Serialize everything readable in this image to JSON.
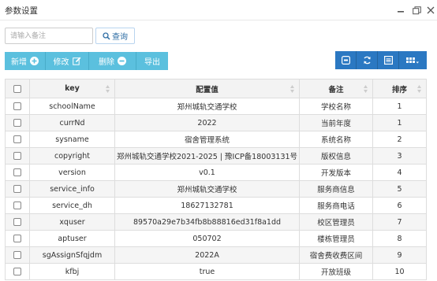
{
  "window": {
    "title": "参数设置"
  },
  "search": {
    "placeholder": "请输入备注",
    "button_label": "查询"
  },
  "actions": {
    "add": "新增",
    "edit": "修改",
    "delete": "删除",
    "export": "导出"
  },
  "columns": {
    "key": "key",
    "value": "配置值",
    "remark": "备注",
    "sort": "排序"
  },
  "rows": [
    {
      "key": "schoolName",
      "value": "郑州城轨交通学校",
      "remark": "学校名称",
      "sort": "1"
    },
    {
      "key": "currNd",
      "value": "2022",
      "remark": "当前年度",
      "sort": "1"
    },
    {
      "key": "sysname",
      "value": "宿舍管理系统",
      "remark": "系统名称",
      "sort": "2"
    },
    {
      "key": "copyright",
      "value": "郑州城轨交通学校2021-2025 | 豫ICP备18003131号",
      "remark": "版权信息",
      "sort": "3"
    },
    {
      "key": "version",
      "value": "v0.1",
      "remark": "开发版本",
      "sort": "4"
    },
    {
      "key": "service_info",
      "value": "郑州城轨交通学校",
      "remark": "服务商信息",
      "sort": "5"
    },
    {
      "key": "service_dh",
      "value": "18627132781",
      "remark": "服务商电话",
      "sort": "6"
    },
    {
      "key": "xquser",
      "value": "89570a29e7b34fb8b88816ed31f8a1dd",
      "remark": "校区管理员",
      "sort": "7"
    },
    {
      "key": "aptuser",
      "value": "050702",
      "remark": "楼栋管理员",
      "sort": "8"
    },
    {
      "key": "sgAssignSfqjdm",
      "value": "2022A",
      "remark": "宿舍费收费区间",
      "sort": "9"
    },
    {
      "key": "kfbj",
      "value": "true",
      "remark": "开放班级",
      "sort": "10"
    }
  ],
  "colors": {
    "action": "#5bc0de",
    "tool": "#2b78c2",
    "accent": "#2e6da4"
  },
  "icons": {
    "window": [
      "minimize-icon",
      "maximize-icon",
      "close-icon"
    ],
    "tools": [
      "toggle-icon",
      "refresh-icon",
      "list-view-icon",
      "columns-icon"
    ]
  }
}
